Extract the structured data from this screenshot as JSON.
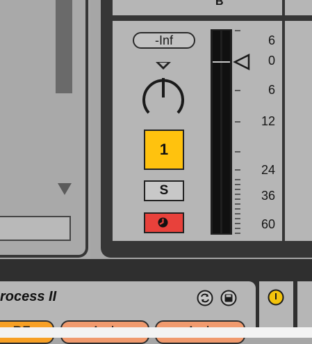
{
  "mixer": {
    "track_label": "B",
    "volume_readout": "-Inf",
    "track_number": "1",
    "solo_label": "S",
    "scale_labels": [
      "6",
      "0",
      "6",
      "12",
      "24",
      "36",
      "60"
    ]
  },
  "rack": {
    "title": "rocess II",
    "chips": [
      "RF",
      "Amb",
      "Amb"
    ]
  },
  "colors": {
    "track_active": "#ffc20e",
    "arm": "#e8413b",
    "chip_orange": "#f7a025",
    "chip_salmon": "#f09a6e",
    "power_on": "#f3c30c"
  }
}
